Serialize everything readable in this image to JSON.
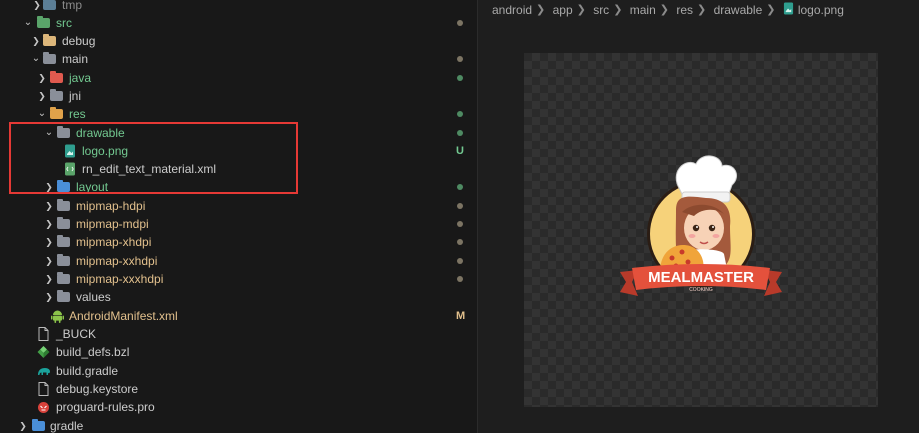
{
  "explorer": {
    "rows": [
      {
        "label": "tmp",
        "kind": "folder",
        "color": "dim"
      },
      {
        "label": "src",
        "kind": "folder",
        "color": "green"
      },
      {
        "label": "debug",
        "kind": "folder",
        "color": "white"
      },
      {
        "label": "main",
        "kind": "folder",
        "color": "white"
      },
      {
        "label": "java",
        "kind": "folder",
        "color": "green"
      },
      {
        "label": "jni",
        "kind": "folder",
        "color": "white"
      },
      {
        "label": "res",
        "kind": "folder",
        "color": "green"
      },
      {
        "label": "drawable",
        "kind": "folder",
        "color": "green"
      },
      {
        "label": "logo.png",
        "kind": "file",
        "color": "green",
        "badge": "U"
      },
      {
        "label": "rn_edit_text_material.xml",
        "kind": "file",
        "color": "white"
      },
      {
        "label": "layout",
        "kind": "folder",
        "color": "green"
      },
      {
        "label": "mipmap-hdpi",
        "kind": "folder",
        "color": "yellow"
      },
      {
        "label": "mipmap-mdpi",
        "kind": "folder",
        "color": "yellow"
      },
      {
        "label": "mipmap-xhdpi",
        "kind": "folder",
        "color": "yellow"
      },
      {
        "label": "mipmap-xxhdpi",
        "kind": "folder",
        "color": "yellow"
      },
      {
        "label": "mipmap-xxxhdpi",
        "kind": "folder",
        "color": "yellow"
      },
      {
        "label": "values",
        "kind": "folder",
        "color": "white"
      },
      {
        "label": "AndroidManifest.xml",
        "kind": "file",
        "color": "yellow",
        "badge": "M"
      },
      {
        "label": "_BUCK",
        "kind": "file",
        "color": "white"
      },
      {
        "label": "build_defs.bzl",
        "kind": "file",
        "color": "white"
      },
      {
        "label": "build.gradle",
        "kind": "file",
        "color": "white"
      },
      {
        "label": "debug.keystore",
        "kind": "file",
        "color": "white"
      },
      {
        "label": "proguard-rules.pro",
        "kind": "file",
        "color": "white"
      },
      {
        "label": "gradle",
        "kind": "folder",
        "color": "white"
      }
    ],
    "icons": {
      "folder": "folder-icon",
      "png": "image-file-icon",
      "xml": "xml-file-icon",
      "android": "android-icon",
      "bzl": "bazel-icon",
      "gradle": "gradle-icon"
    }
  },
  "breadcrumb": [
    "android",
    "app",
    "src",
    "main",
    "res",
    "drawable",
    "logo.png"
  ],
  "preview": {
    "logo_text": "MEALMASTER",
    "logo_subtext": "COOKING"
  },
  "colors": {
    "git_added": "#73c991",
    "git_modified": "#e2c08d",
    "highlight_box": "#e53935"
  }
}
